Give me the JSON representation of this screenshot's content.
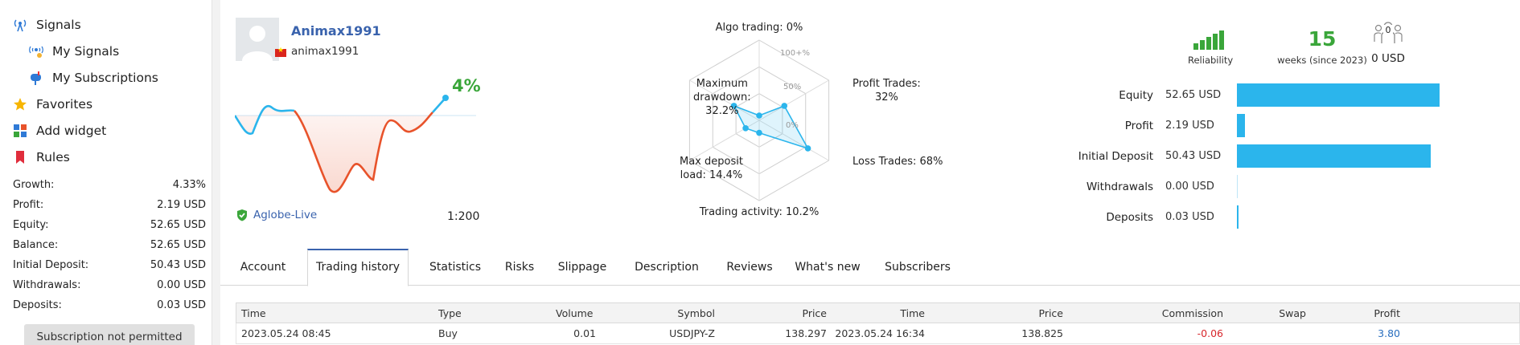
{
  "sidebar": {
    "nav": [
      {
        "label": "Signals",
        "icon": "antenna-icon"
      },
      {
        "label": "My Signals",
        "icon": "signal-user-icon"
      },
      {
        "label": "My Subscriptions",
        "icon": "mailbox-icon"
      },
      {
        "label": "Favorites",
        "icon": "star-icon"
      },
      {
        "label": "Add widget",
        "icon": "widget-grid-icon"
      },
      {
        "label": "Rules",
        "icon": "bookmark-icon"
      }
    ],
    "stats": [
      {
        "label": "Growth:",
        "value": "4.33%"
      },
      {
        "label": "Profit:",
        "value": "2.19 USD"
      },
      {
        "label": "Equity:",
        "value": "52.65 USD"
      },
      {
        "label": "Balance:",
        "value": "52.65 USD"
      },
      {
        "label": "Initial Deposit:",
        "value": "50.43 USD"
      },
      {
        "label": "Withdrawals:",
        "value": "0.00 USD"
      },
      {
        "label": "Deposits:",
        "value": "0.03 USD"
      }
    ],
    "subscription_button": "Subscription not permitted"
  },
  "profile": {
    "username": "Animax1991",
    "handle": "animax1991",
    "growth_percent": "4%",
    "broker": "Aglobe-Live",
    "leverage": "1:200"
  },
  "radar": {
    "labels": {
      "algo": "Algo trading: 0%",
      "profit_trades_1": "Profit Trades:",
      "profit_trades_2": "32%",
      "loss_trades": "Loss Trades: 68%",
      "trading_activity": "Trading activity: 10.2%",
      "max_deposit_1": "Max deposit",
      "max_deposit_2": "load: 14.4%",
      "max_drawdown_1": "Maximum",
      "max_drawdown_2": "drawdown:",
      "max_drawdown_3": "32.2%"
    },
    "scale": {
      "top": "100+%",
      "mid": "50%",
      "low": "0%"
    },
    "values": {
      "algo": 0,
      "profit_trades": 32,
      "loss_trades": 68,
      "trading_activity": 10.2,
      "max_deposit_load": 14.4,
      "max_drawdown": 32.2
    }
  },
  "summary": {
    "reliability_label": "Reliability",
    "reliability_level": 5,
    "weeks": "15",
    "weeks_label": "weeks (since 2023)",
    "subscribers_count": "0",
    "subscribers_usd": "0 USD"
  },
  "financials": [
    {
      "label": "Equity",
      "value": "52.65 USD",
      "amount": 52.65
    },
    {
      "label": "Profit",
      "value": "2.19 USD",
      "amount": 2.19
    },
    {
      "label": "Initial Deposit",
      "value": "50.43 USD",
      "amount": 50.43
    },
    {
      "label": "Withdrawals",
      "value": "0.00 USD",
      "amount": 0.0
    },
    {
      "label": "Deposits",
      "value": "0.03 USD",
      "amount": 0.03
    }
  ],
  "tabs": [
    "Account",
    "Trading history",
    "Statistics",
    "Risks",
    "Slippage",
    "Description",
    "Reviews",
    "What's new",
    "Subscribers"
  ],
  "active_tab": "Trading history",
  "table": {
    "headers": {
      "time": "Time",
      "type": "Type",
      "volume": "Volume",
      "symbol": "Symbol",
      "price": "Price",
      "time2": "Time",
      "price2": "Price",
      "commission": "Commission",
      "swap": "Swap",
      "profit": "Profit"
    },
    "rows": [
      {
        "time": "2023.05.24 08:45",
        "type": "Buy",
        "volume": "0.01",
        "symbol": "USDJPY-Z",
        "price": "138.297",
        "time2": "2023.05.24 16:34",
        "price2": "138.825",
        "commission": "-0.06",
        "swap": "",
        "profit": "3.80"
      }
    ]
  },
  "colors": {
    "accent": "#2bb5ec",
    "green": "#3aa63a",
    "link": "#3a63ad",
    "negative": "#d7262b",
    "growth_line": "#e8532b"
  }
}
